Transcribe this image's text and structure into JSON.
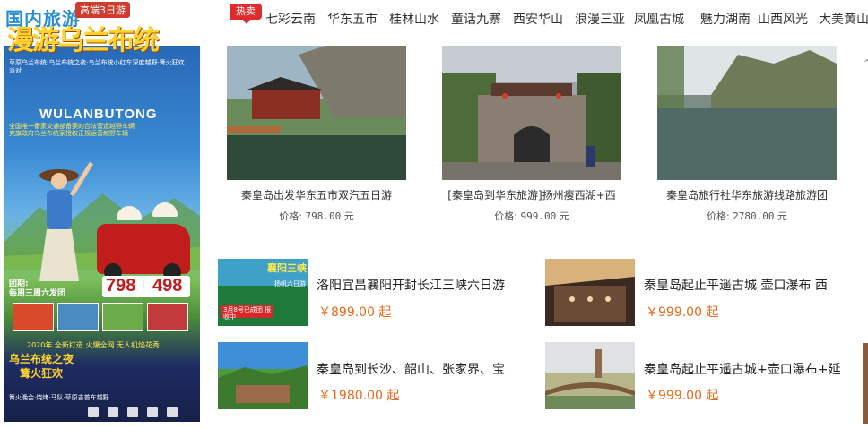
{
  "section": {
    "title": "国内旅游"
  },
  "hot_badge": "热卖",
  "tabs": [
    "七彩云南",
    "华东五市",
    "桂林山水",
    "童话九寨",
    "西安华山",
    "浪漫三亚",
    "凤凰古城",
    "魅力湖南",
    "山西风光",
    "大美黄山"
  ],
  "banner": {
    "tag": "高端3日游",
    "title": "漫游乌兰布统",
    "lines": "草原乌兰布统·乌兰布统之夜·乌兰布统小红车深度越野·篝火狂欢派对",
    "en": "WULANBUTONG",
    "sub1": "全国唯一番家交通部备案的合法营运越野车辆",
    "sub2": "克旗政府乌兰布统家授权正规运营越野车辆",
    "group_label": "团期:",
    "group_days": "每周三周六发团",
    "price_a": "798",
    "price_b": "498",
    "gift": "2020年 全新打造 火爆全网 无人机焰花秀",
    "night1": "乌兰布统之夜",
    "night2": "篝火狂欢",
    "foot": "篝火晚会·烧烤·马队·草原吉普车越野"
  },
  "cards": [
    {
      "title": "秦皇岛出发华东五市双汽五日游",
      "price_label": "价格:",
      "price": "798.00",
      "unit": "元"
    },
    {
      "title": "[秦皇岛到华东旅游]扬州瘦西湖+西",
      "price_label": "价格:",
      "price": "999.00",
      "unit": "元"
    },
    {
      "title": "秦皇岛旅行社华东旅游线路旅游团",
      "price_label": "价格:",
      "price": "2780.00",
      "unit": "元"
    }
  ],
  "list": [
    {
      "title": "洛阳宜昌襄阳开封长江三峡六日游",
      "price": "￥899.00 起",
      "img_text_top": "襄阳三峡",
      "img_text_mid": "扬帆六日游",
      "img_text_btm": "3月8号已成团 报收中"
    },
    {
      "title": "秦皇岛起止平遥古城  壶口瀑布  西",
      "price": "￥999.00 起"
    },
    {
      "title": "秦皇岛到长沙、韶山、张家界、宝",
      "price": "￥1980.00 起"
    },
    {
      "title": "秦皇岛起止平遥古城+壶口瀑布+延",
      "price": "￥999.00 起"
    }
  ],
  "colors": {
    "title_blue": "#2a8fd0",
    "hot_red": "#e02b2b",
    "price_orange": "#e86a19"
  }
}
